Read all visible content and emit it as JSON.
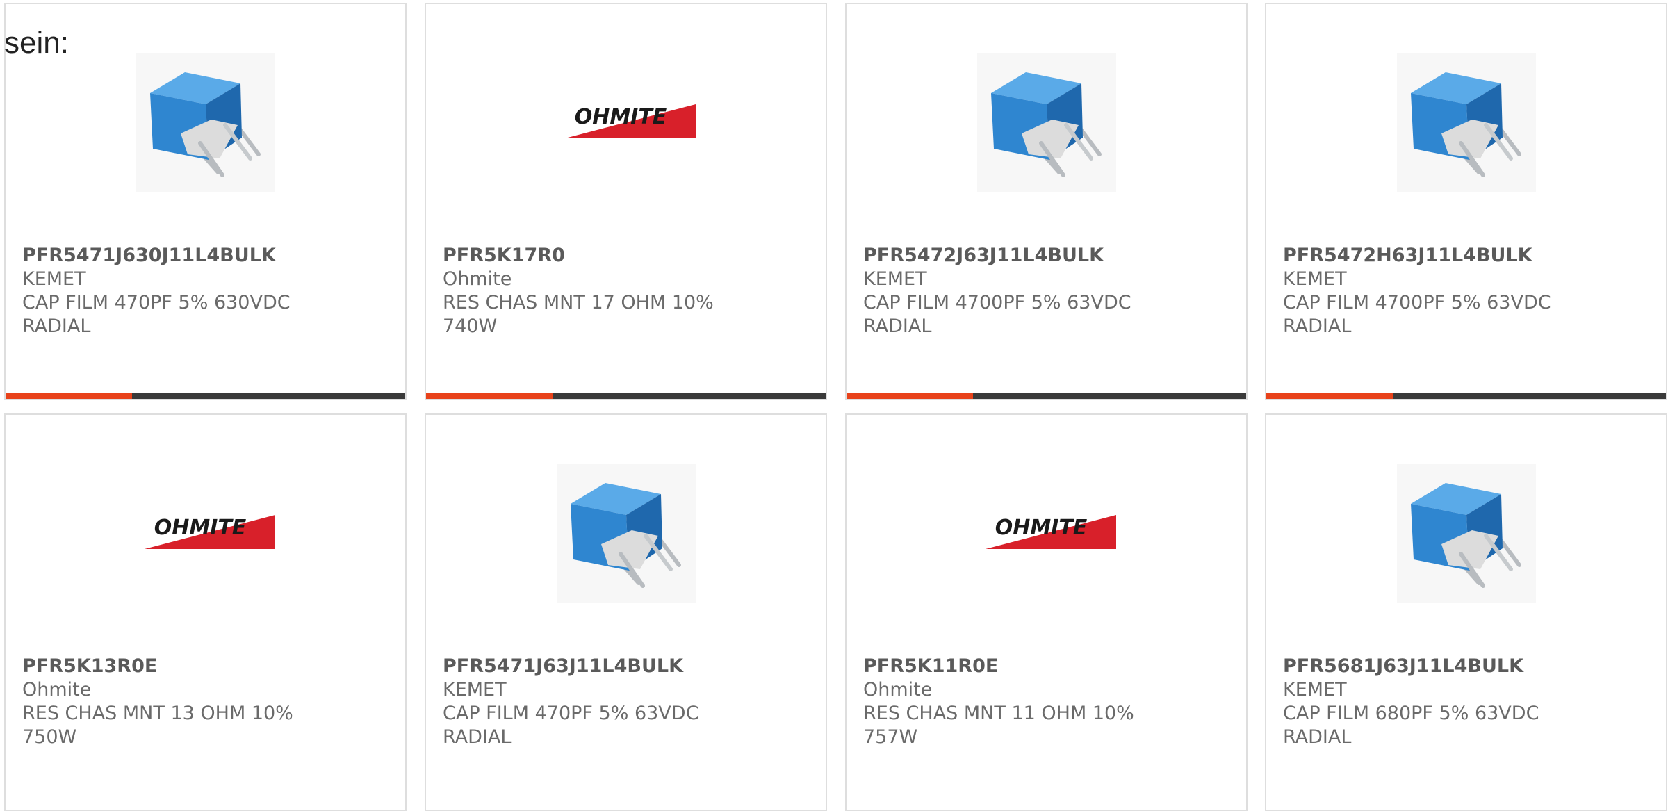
{
  "intro_text": "sein:",
  "colors": {
    "accent": "#e8421a",
    "bar": "#3a3a3a",
    "ohmite_red": "#d8202a",
    "capacitor_blue": "#2f86d0"
  },
  "products": [
    {
      "part_number": "PFR5471J630J11L4BULK",
      "manufacturer": "KEMET",
      "description": "CAP FILM 470PF 5% 630VDC RADIAL",
      "image": "kemet-capacitor-image"
    },
    {
      "part_number": "PFR5K17R0",
      "manufacturer": "Ohmite",
      "description": "RES CHAS MNT 17 OHM 10% 740W",
      "image": "ohmite-logo"
    },
    {
      "part_number": "PFR5472J63J11L4BULK",
      "manufacturer": "KEMET",
      "description": "CAP FILM 4700PF 5% 63VDC RADIAL",
      "image": "kemet-capacitor-image"
    },
    {
      "part_number": "PFR5472H63J11L4BULK",
      "manufacturer": "KEMET",
      "description": "CAP FILM 4700PF 5% 63VDC RADIAL",
      "image": "kemet-capacitor-image"
    },
    {
      "part_number": "PFR5K13R0E",
      "manufacturer": "Ohmite",
      "description": "RES CHAS MNT 13 OHM 10% 750W",
      "image": "ohmite-logo"
    },
    {
      "part_number": "PFR5471J63J11L4BULK",
      "manufacturer": "KEMET",
      "description": "CAP FILM 470PF 5% 63VDC RADIAL",
      "image": "kemet-capacitor-image"
    },
    {
      "part_number": "PFR5K11R0E",
      "manufacturer": "Ohmite",
      "description": "RES CHAS MNT 11 OHM 10% 757W",
      "image": "ohmite-logo"
    },
    {
      "part_number": "PFR5681J63J11L4BULK",
      "manufacturer": "KEMET",
      "description": "CAP FILM 680PF 5% 63VDC RADIAL",
      "image": "kemet-capacitor-image"
    }
  ],
  "ohmite_logo_text": "OHMITE"
}
